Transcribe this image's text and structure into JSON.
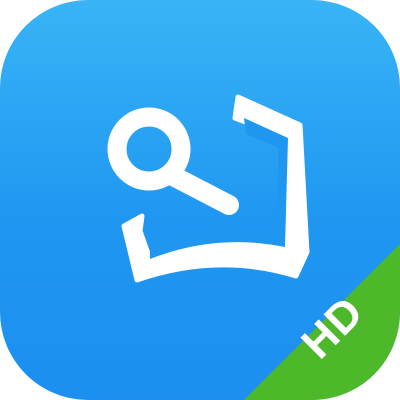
{
  "app_icon": {
    "name": "search-book-icon",
    "badge_text": "HD",
    "colors": {
      "background_top": "#39b4f6",
      "background_bottom": "#1c8ff0",
      "glyph": "#ffffff",
      "ribbon": "#4cb82a"
    }
  }
}
